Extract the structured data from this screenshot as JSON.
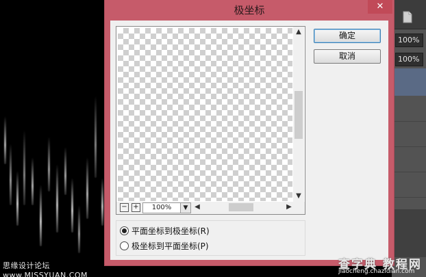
{
  "dialog": {
    "title": "极坐标",
    "close_glyph": "✕",
    "ok_label": "确定",
    "cancel_label": "取消",
    "zoom_value": "100%",
    "zoom_out_glyph": "−",
    "zoom_in_glyph": "+",
    "options": [
      {
        "label": "平面坐标到极坐标(R)",
        "checked": true
      },
      {
        "label": "极坐标到平面坐标(P)",
        "checked": false
      }
    ]
  },
  "ps_panel": {
    "field_top": "100%",
    "field_bottom": "100%"
  },
  "watermarks": {
    "left": "思缘设计论坛 www.MISSYUAN.COM",
    "site": "查字典 教程网",
    "url": "jiaocheng.chazidian.com"
  },
  "icons": {
    "close": "close-icon",
    "scroll_up": "arrow-up-icon",
    "scroll_down": "arrow-down-icon",
    "scroll_left": "arrow-left-icon",
    "scroll_right": "arrow-right-icon",
    "dropdown": "chevron-down-icon",
    "document": "document-icon"
  },
  "colors": {
    "dialog_frame": "#c65b6a",
    "dialog_body": "#f0f0f0",
    "default_button_border": "#3c7fb1",
    "canvas_bg": "#000000",
    "panel_bg": "#535353"
  }
}
